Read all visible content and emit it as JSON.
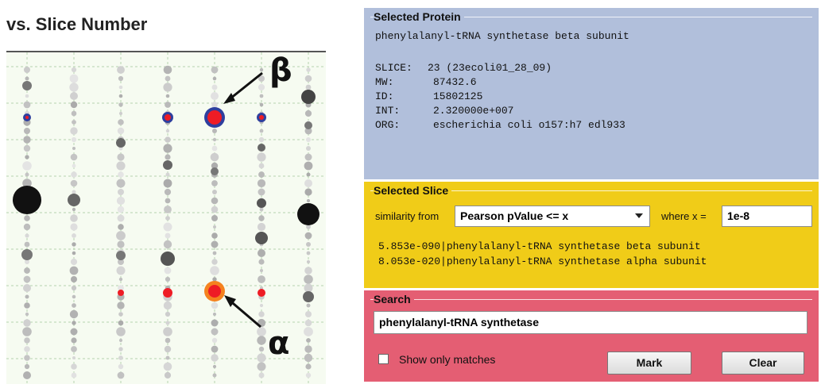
{
  "plot": {
    "title": "vs. Slice Number"
  },
  "annotations": {
    "beta": "β",
    "alpha": "α"
  },
  "selected_protein": {
    "title": "Selected Protein",
    "name": "phenylalanyl-tRNA synthetase beta subunit",
    "slice_label": "SLICE:",
    "slice_value": "23 (23ecoli01_28_09)",
    "mw_label": "MW:",
    "mw_value": "87432.6",
    "id_label": "ID:",
    "id_value": "15802125",
    "int_label": "INT:",
    "int_value": "2.320000e+007",
    "org_label": "ORG:",
    "org_value": "escherichia coli o157:h7 edl933"
  },
  "selected_slice": {
    "title": "Selected Slice",
    "similarity_label": "similarity from",
    "similarity_value": "Pearson pValue <= x",
    "where_label": "where x =",
    "x_value": "1e-8",
    "results": [
      "5.853e-090|phenylalanyl-tRNA synthetase beta subunit",
      "8.053e-020|phenylalanyl-tRNA synthetase alpha subunit"
    ]
  },
  "search": {
    "title": "Search",
    "query": "phenylalanyl-tRNA synthetase",
    "show_only_matches_label": "Show only matches",
    "show_only_matches_checked": false,
    "mark_label": "Mark",
    "clear_label": "Clear"
  },
  "colors": {
    "protein_panel": "#b1bfdb",
    "slice_panel": "#f0cc18",
    "search_panel": "#e45e73",
    "highlight_beta_fill": "#ee1c25",
    "highlight_beta_ring": "#2e3f9e",
    "highlight_alpha_fill": "#ee1c25",
    "highlight_alpha_ring": "#f5821f"
  }
}
